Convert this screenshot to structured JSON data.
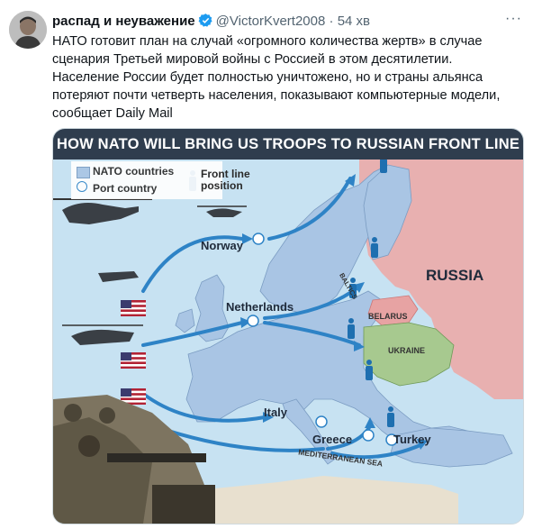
{
  "tweet": {
    "display_name": "распад и неуважение",
    "handle": "@VictorKvert2008",
    "separator": "·",
    "time": "54 хв",
    "more": "···",
    "text": "НАТО готовит план на случай «огромного количества жертв» в случае сценария Третьей мировой войны с Россией в этом десятилетии. Население России будет полностью уничтожено, но и страны альянса потеряют почти четверть населения, показывают компьютерные модели, сообщает Daily Mail"
  },
  "image": {
    "title": "HOW NATO WILL BRING US TROOPS TO RUSSIAN FRONT LINE",
    "legend": {
      "nato_countries": "NATO countries",
      "port_country": "Port country",
      "front_line": "Front line position"
    },
    "labels": {
      "russia": "RUSSIA",
      "norway": "Norway",
      "netherlands": "Netherlands",
      "italy": "Italy",
      "greece": "Greece",
      "turkey": "Turkey",
      "belarus": "BELARUS",
      "ukraine": "UKRAINE",
      "baltics": "BALTICS",
      "mediterranean": "MEDITERRANEAN SEA"
    }
  },
  "colors": {
    "banner": "#2f3d4e",
    "nato": "#a9c5e4",
    "russia": "#e8b0b0",
    "ukraine": "#a7c98f",
    "belarus": "#e7a3a3",
    "sea": "#c7e2f2",
    "arrow": "#2e83c6",
    "verified": "#1d9bf0"
  }
}
